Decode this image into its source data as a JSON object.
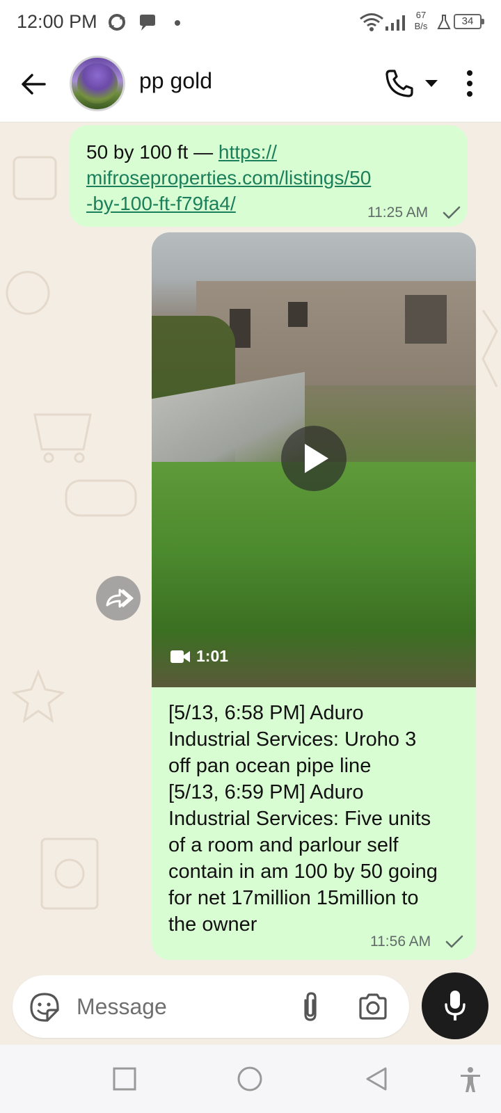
{
  "status_bar": {
    "time": "12:00 PM",
    "net_speed_value": "67",
    "net_speed_unit": "B/s",
    "battery": "34",
    "icons": [
      "sync-icon",
      "message-bubble-icon",
      "dot-icon",
      "wifi-icon",
      "signal-icon",
      "flask-icon",
      "battery-icon"
    ]
  },
  "header": {
    "contact_name": "pp gold",
    "icons": [
      "back-arrow-icon",
      "contact-avatar",
      "phone-icon",
      "chevron-down-icon",
      "more-vert-icon"
    ]
  },
  "messages": [
    {
      "text_prefix": "50 by 100 ft — ",
      "link": "https://mifroseproperties.com/listings/50-by-100-ft-f79fa4/",
      "link_line1": "https://",
      "link_line2": "mifroseproperties.com/listings/50",
      "link_line3": "-by-100-ft-f79fa4/",
      "time": "11:25 AM",
      "status": "sent"
    },
    {
      "type": "video",
      "duration": "1:01",
      "caption": "[5/13, 6:58 PM] Aduro\nIndustrial Services: Uroho 3\noff pan ocean pipe line\n[5/13, 6:59 PM] Aduro\nIndustrial Services: Five units\nof a room and parlour self\ncontain in am 100 by 50 going\nfor net 17million 15million to\nthe owner",
      "time": "11:56 AM",
      "status": "sent"
    }
  ],
  "composer": {
    "placeholder": "Message",
    "icons": [
      "sticker-icon",
      "paperclip-icon",
      "camera-icon",
      "mic-icon"
    ]
  },
  "nav_bar": {
    "icons": [
      "recents-square-icon",
      "home-circle-icon",
      "back-triangle-icon",
      "accessibility-icon"
    ]
  },
  "colors": {
    "bubble": "#d9fdd3",
    "chat_bg": "#f3ede4",
    "link": "#1a7f5a",
    "mic_button": "#1c1c1c"
  }
}
